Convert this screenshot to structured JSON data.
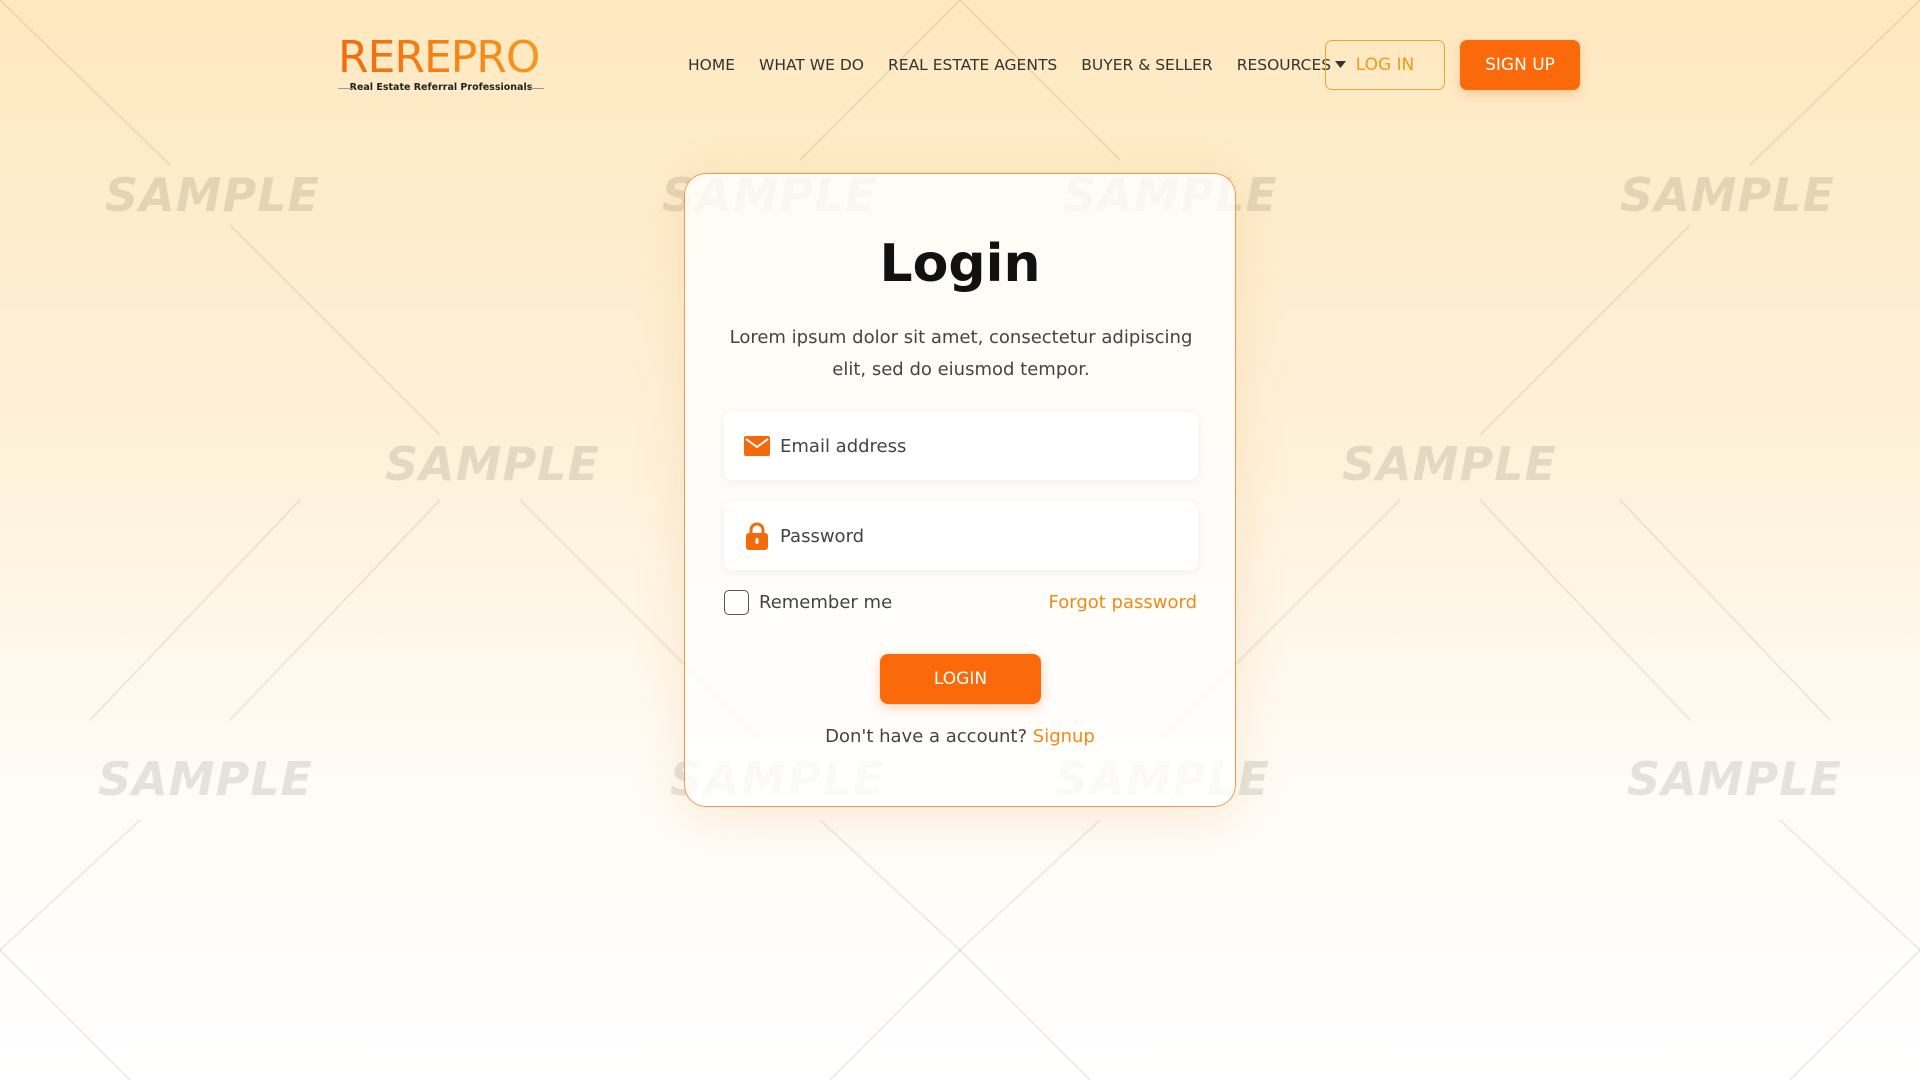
{
  "logo": {
    "brand": "REREPRO",
    "tagline": "Real Estate Referral Professionals"
  },
  "nav": {
    "items": [
      {
        "label": "HOME"
      },
      {
        "label": "WHAT WE DO"
      },
      {
        "label": "REAL ESTATE AGENTS"
      },
      {
        "label": "BUYER & SELLER"
      },
      {
        "label": "RESOURCES",
        "icon": "caret-down-icon"
      }
    ]
  },
  "header": {
    "login_label": "LOG IN",
    "signup_label": "SIGN UP"
  },
  "watermark": {
    "text": "SAMPLE"
  },
  "card": {
    "title": "Login",
    "subtitle": "Lorem ipsum dolor sit amet, consectetur adipiscing elit, sed do eiusmod tempor.",
    "email": {
      "placeholder": "Email address",
      "value": "",
      "icon": "mail-icon"
    },
    "password": {
      "placeholder": "Password",
      "value": "",
      "icon": "lock-icon"
    },
    "remember_label": "Remember me",
    "remember_checked": false,
    "forgot_label": "Forgot password",
    "login_button": "LOGIN",
    "no_account_text": "Don't have a account?",
    "signup_link": "Signup"
  },
  "colors": {
    "accent": "#fa6a0a",
    "accent_text": "#ef8b14",
    "outline": "#f0a52f"
  }
}
